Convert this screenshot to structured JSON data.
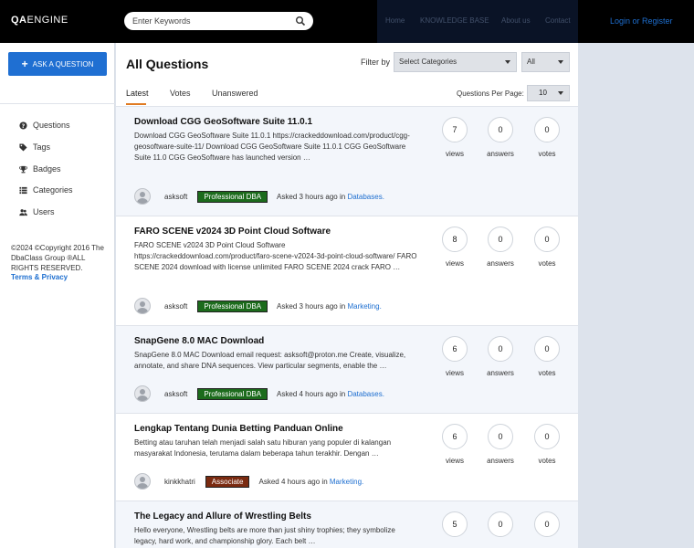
{
  "header": {
    "logo_prefix": "QA",
    "logo_suffix": "ENGINE",
    "search_placeholder": "Enter Keywords",
    "nav": [
      "Home",
      "KNOWLEDGE BASE",
      "About us",
      "Contact"
    ],
    "login": "Login or Register"
  },
  "sidebar": {
    "ask_button": "ASK A QUESTION",
    "items": [
      {
        "label": "Questions",
        "icon": "question-circle-icon"
      },
      {
        "label": "Tags",
        "icon": "tag-icon"
      },
      {
        "label": "Badges",
        "icon": "trophy-icon"
      },
      {
        "label": "Categories",
        "icon": "list-icon"
      },
      {
        "label": "Users",
        "icon": "users-icon"
      }
    ],
    "copyright": "©2024 ©Copyright 2016 The DbaClass Group ®ALL RIGHTS RESERVED.",
    "terms": "Terms & Privacy"
  },
  "main": {
    "title": "All Questions",
    "filter_label": "Filter by",
    "category_select": "Select Categories",
    "status_select": "All",
    "tabs": [
      "Latest",
      "Votes",
      "Unanswered"
    ],
    "per_page_label": "Questions Per Page:",
    "per_page_value": "10",
    "stat_labels": {
      "views": "views",
      "answers": "answers",
      "votes": "votes"
    },
    "questions": [
      {
        "title": "Download CGG GeoSoftware Suite 11.0.1",
        "excerpt": "Download CGG GeoSoftware Suite 11.0.1 https://crackeddownload.com/product/cgg-geosoftware-suite-11/  Download CGG GeoSoftware Suite 11.0.1 CGG GeoSoftware Suite 11.0 CGG GeoSoftware has launched version …",
        "user": "asksoft",
        "badge": "Professional DBA",
        "asked": "Asked 3 hours ago in",
        "category": "Databases.",
        "views": "7",
        "answers": "0",
        "votes": "0"
      },
      {
        "title": "FARO SCENE v2024 3D Point Cloud Software",
        "excerpt": "FARO SCENE v2024 3D Point Cloud Software https://crackeddownload.com/product/faro-scene-v2024-3d-point-cloud-software/ FARO SCENE 2024 download with license unlimited FARO SCENE 2024 crack FARO …",
        "user": "asksoft",
        "badge": "Professional DBA",
        "asked": "Asked 3 hours ago in",
        "category": "Marketing.",
        "views": "8",
        "answers": "0",
        "votes": "0"
      },
      {
        "title": "SnapGene 8.0 MAC Download",
        "excerpt": "SnapGene 8.0 MAC Download email request: asksoft@proton.me  Create, visualize, annotate, and share DNA sequences. View particular segments, enable the …",
        "user": "asksoft",
        "badge": "Professional DBA",
        "asked": "Asked 4 hours ago in",
        "category": "Databases.",
        "views": "6",
        "answers": "0",
        "votes": "0"
      },
      {
        "title": "Lengkap Tentang Dunia Betting Panduan Online",
        "excerpt": "Betting atau taruhan telah menjadi salah satu hiburan yang populer di kalangan masyarakat Indonesia, terutama dalam beberapa tahun terakhir. Dengan …",
        "user": "kinkkhatri",
        "badge": "Associate",
        "asked": "Asked 4 hours ago in",
        "category": "Marketing.",
        "views": "6",
        "answers": "0",
        "votes": "0"
      },
      {
        "title": "The Legacy and Allure of Wrestling Belts",
        "excerpt": "Hello everyone, Wrestling belts are more than just shiny trophies; they symbolize legacy, hard work, and championship glory. Each belt …",
        "user": "",
        "badge": "",
        "asked": "",
        "category": "",
        "views": "5",
        "answers": "0",
        "votes": "0"
      }
    ]
  }
}
